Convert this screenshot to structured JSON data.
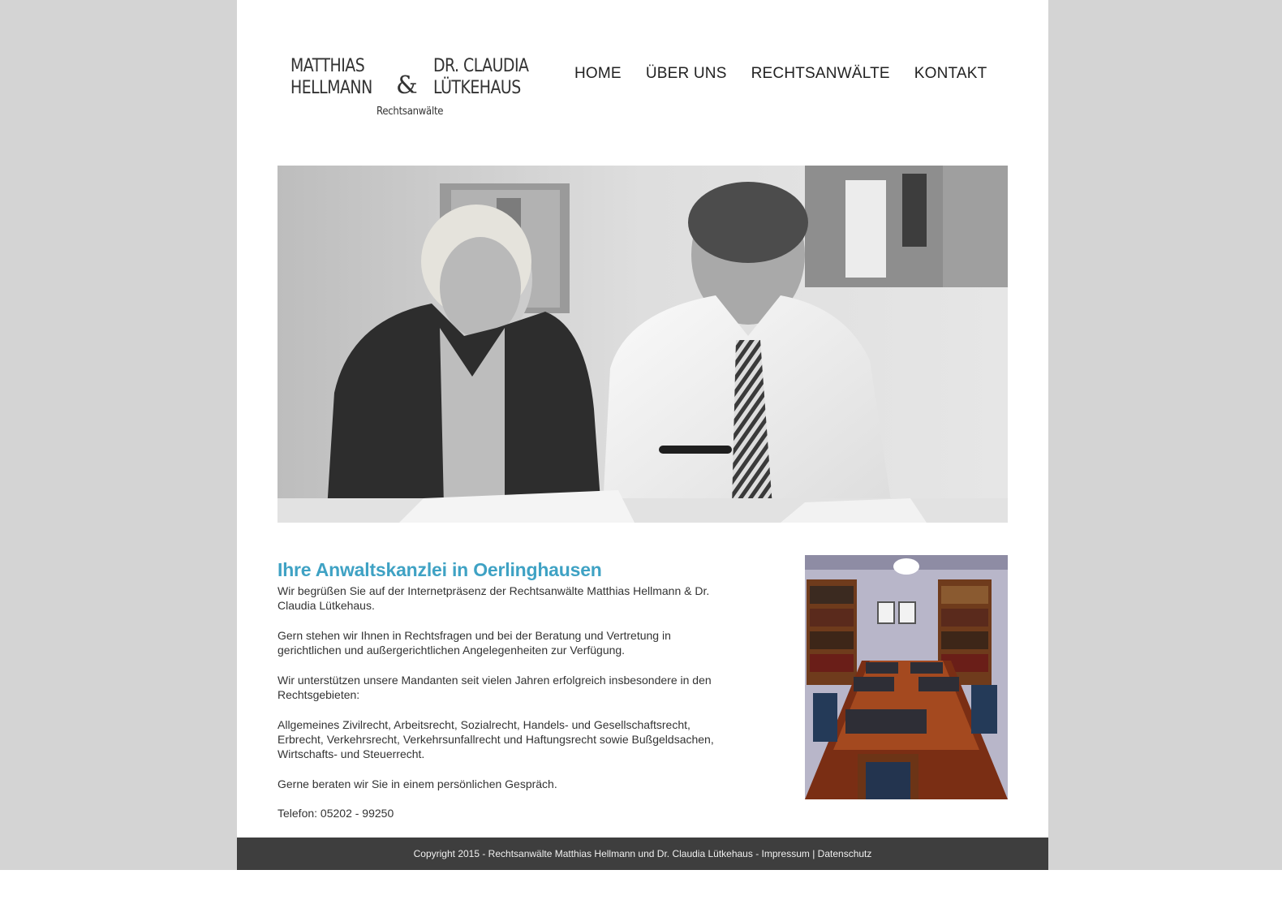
{
  "logo": {
    "name_left_line1": "MATTHIAS",
    "name_left_line2": "HELLMANN",
    "ampersand": "&",
    "name_right_line1": "DR. CLAUDIA",
    "name_right_line2": "LÜTKEHAUS",
    "subtitle": "Rechtsanwälte"
  },
  "nav": {
    "items": [
      {
        "label": "HOME"
      },
      {
        "label": "ÜBER UNS"
      },
      {
        "label": "RECHTSANWÄLTE"
      },
      {
        "label": "KONTAKT"
      }
    ]
  },
  "main": {
    "heading": "Ihre Anwaltskanzlei in Oerlinghausen",
    "paragraphs": [
      "Wir begrüßen Sie auf der Internetpräsenz der Rechtsanwälte Matthias Hellmann & Dr. Claudia Lütkehaus.",
      "Gern stehen wir Ihnen in Rechtsfragen und bei der Beratung und Vertretung in gerichtlichen und außergerichtlichen Angelegenheiten zur Verfügung.",
      "Wir unterstützen unsere Mandanten seit vielen Jahren erfolgreich insbesondere in den Rechtsgebieten:",
      "Allgemeines Zivilrecht, Arbeitsrecht, Sozialrecht, Handels- und Gesellschaftsrecht, Erbrecht, Verkehrsrecht, Verkehrsunfallrecht und Haftungsrecht sowie Bußgeldsachen, Wirtschafts- und Steuerrecht.",
      "Gerne beraten wir Sie in einem persönlichen Gespräch.",
      "Telefon: 05202 - 99250"
    ]
  },
  "footer": {
    "copyright": "Copyright 2015 - Rechtsanwälte Matthias Hellmann und Dr. Claudia Lütkehaus - ",
    "impressum": "Impressum",
    "separator": " | ",
    "datenschutz": "Datenschutz"
  },
  "colors": {
    "accent": "#3fa2c4",
    "footer_bg": "#3e3e3e",
    "outer_bg": "#d4d4d4"
  }
}
